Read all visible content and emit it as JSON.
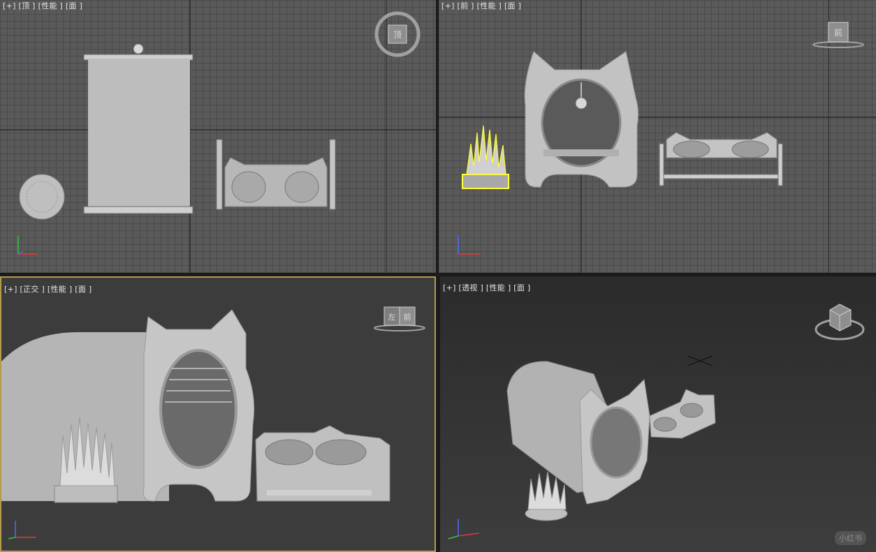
{
  "viewports": {
    "top": {
      "label": "[+] [顶 ] [性能 ] [面 ]"
    },
    "front": {
      "label": "[+] [前 ] [性能 ] [面 ]"
    },
    "ortho": {
      "label": "[+] [正交 ] [性能 ] [面 ]"
    },
    "perspective": {
      "label": "[+] [透视 ] [性能 ] [面 ]"
    }
  },
  "viewcube": {
    "top_face": "顶",
    "front_face": "前",
    "ortho_left": "左",
    "ortho_front": "前"
  },
  "axes": {
    "x": "x",
    "y": "y",
    "z": "z"
  },
  "watermark": "小红书",
  "colors": {
    "grid_bg": "#5a5a5a",
    "grid_line": "#4a4a4a",
    "model": "#bcbcbc",
    "active_border": "#b59b4c",
    "selection": "#ffff33",
    "axis_x": "#e23b3b",
    "axis_y": "#39c639",
    "axis_z": "#4a6cff"
  }
}
